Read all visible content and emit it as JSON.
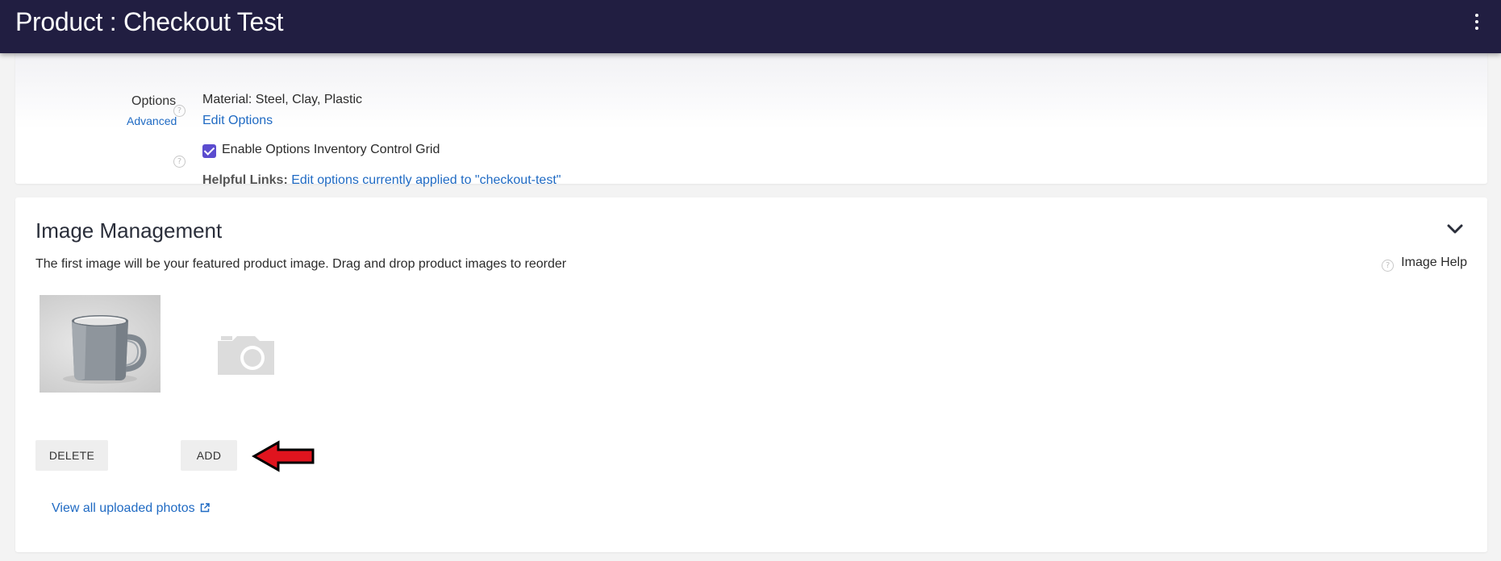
{
  "header": {
    "title": "Product : Checkout Test",
    "menu_icon": "more-vert-icon"
  },
  "options_section": {
    "label": "Options",
    "advanced_link": "Advanced",
    "value": "Material: Steel, Clay, Plastic",
    "edit_link": "Edit Options",
    "inventory_checkbox": {
      "label": "Enable Options Inventory Control Grid",
      "checked": true
    },
    "helpful_links_label": "Helpful Links:",
    "helpful_link_text": "Edit options currently applied to \"checkout-test\""
  },
  "image_management": {
    "title": "Image Management",
    "description": "The first image will be your featured product image. Drag and drop product images to reorder",
    "help_link": "Image Help",
    "images": [
      {
        "alt": "grey mug product image",
        "icon": "mug-photo"
      }
    ],
    "add_placeholder_icon": "camera-icon",
    "delete_button": "DELETE",
    "add_button": "ADD",
    "view_all_link": "View all uploaded photos"
  },
  "colors": {
    "header_bg": "#211e41",
    "link": "#1f6ac3",
    "checkbox": "#5b4ccf",
    "annotation_arrow": "#e0141e"
  }
}
